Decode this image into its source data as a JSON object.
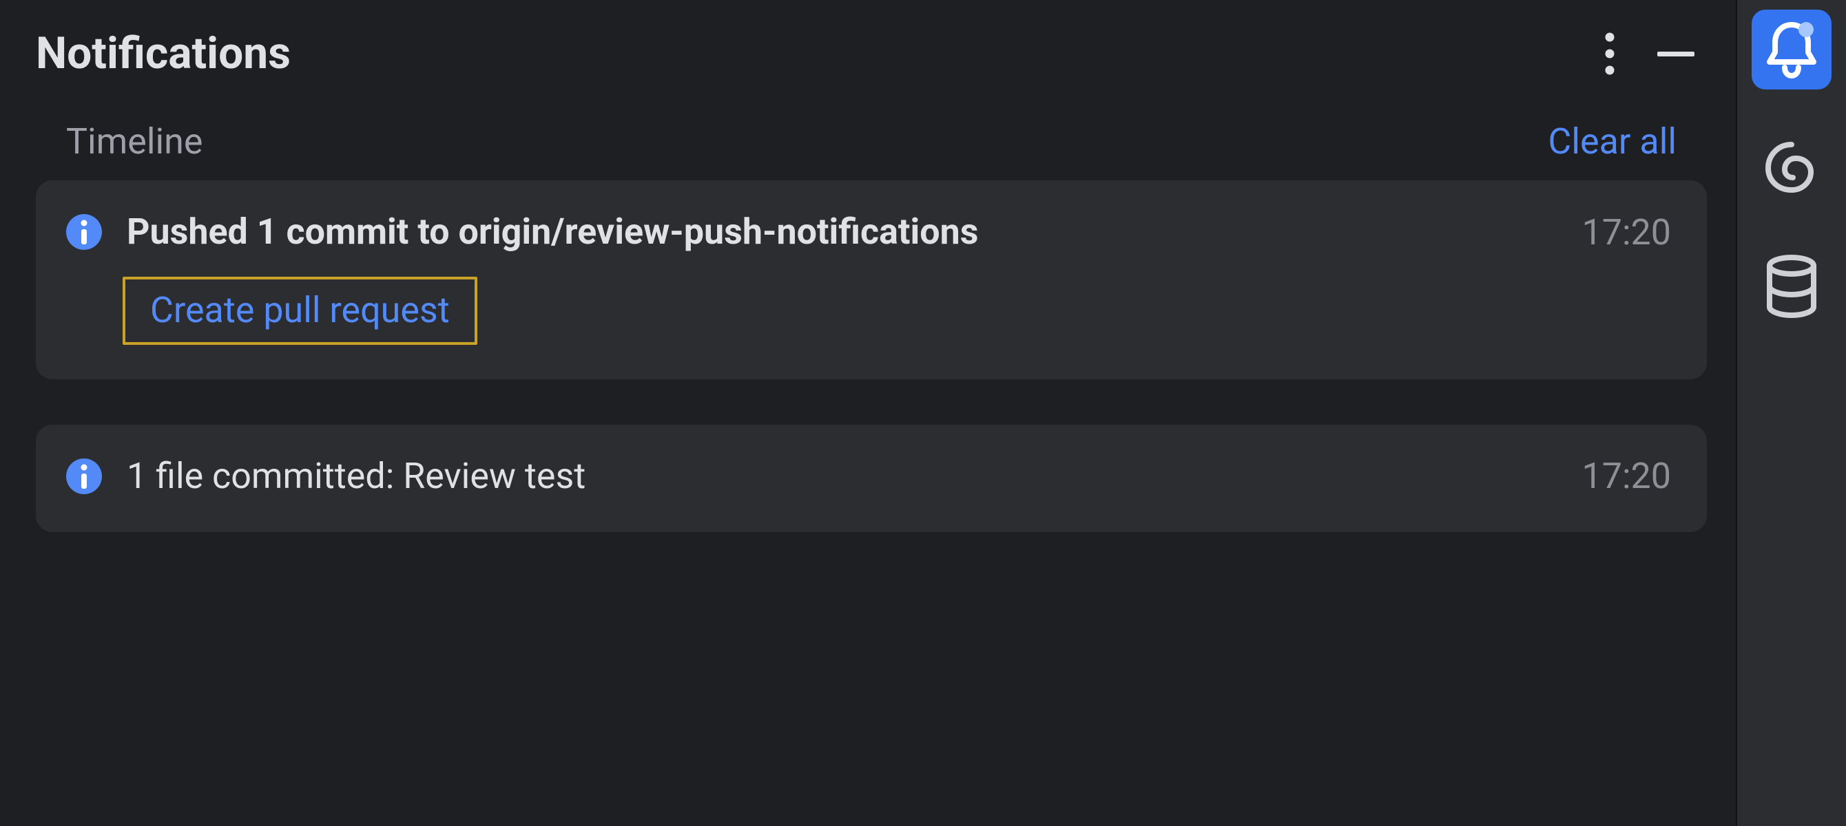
{
  "header": {
    "title": "Notifications"
  },
  "section": {
    "label": "Timeline",
    "clear_label": "Clear all"
  },
  "notifications": [
    {
      "title": "Pushed 1 commit to origin/review-push-notifications",
      "time": "17:20",
      "action": "Create pull request"
    },
    {
      "title": "1 file committed: Review test",
      "time": "17:20"
    }
  ]
}
